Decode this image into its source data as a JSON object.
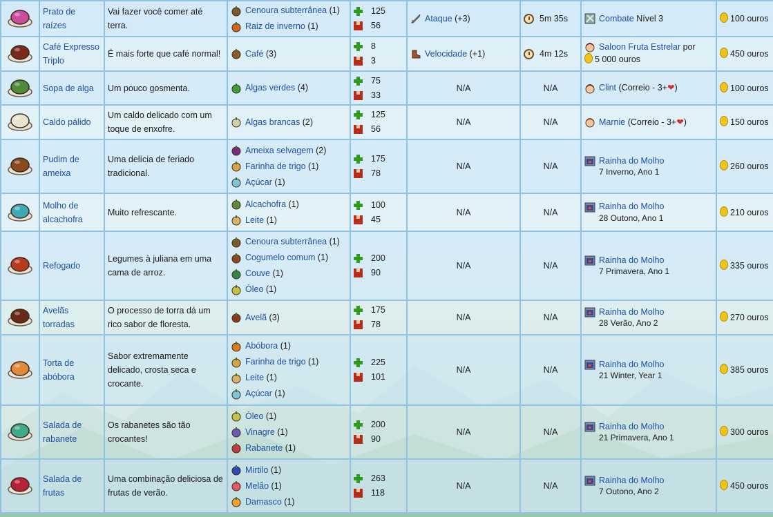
{
  "rows": [
    {
      "name": "Prato de raízes",
      "desc": "Vai fazer você comer até terra.",
      "ingredients": [
        {
          "name": "Cenoura subterrânea",
          "qty": "(1)",
          "icon": "carrot-icon",
          "color": "#7a5a2a"
        },
        {
          "name": "Raiz de inverno",
          "qty": "(1)",
          "icon": "winter-root-icon",
          "color": "#d9621f"
        }
      ],
      "energy": "125",
      "health": "56",
      "buff_name": "Ataque",
      "buff_value": "(+3)",
      "buff_icon": "sword-icon",
      "duration": "5m 35s",
      "source_link": "Combate",
      "source_extra": "Nível 3",
      "source_icon": "combat-icon",
      "price": "100 ouros",
      "dish_color": "#c94f9e",
      "dish_icon": "root-platter-icon"
    },
    {
      "name": "Café Expresso Triplo",
      "desc": "É mais forte que café normal!",
      "ingredients": [
        {
          "name": "Café",
          "qty": "(3)",
          "icon": "coffee-icon",
          "color": "#8b5a2b"
        }
      ],
      "energy": "8",
      "health": "3",
      "buff_name": "Velocidade",
      "buff_value": "(+1)",
      "buff_icon": "boot-icon",
      "duration": "4m 12s",
      "source_link": "Saloon Fruta Estrelar",
      "source_extra": "por",
      "source_price": "5 000 ouros",
      "source_icon": "gus-icon",
      "price": "450 ouros",
      "dish_color": "#7a2a1a",
      "dish_icon": "espresso-icon"
    },
    {
      "name": "Sopa de alga",
      "desc": "Um pouco gosmenta.",
      "ingredients": [
        {
          "name": "Algas verdes",
          "qty": "(4)",
          "icon": "green-algae-icon",
          "color": "#3f9e3a"
        }
      ],
      "energy": "75",
      "health": "33",
      "buff_na": "N/A",
      "duration_na": "N/A",
      "source_link": "Clint",
      "source_extra": "(Correio - 3+",
      "source_icon": "clint-icon",
      "price": "100 ouros",
      "dish_color": "#4d8d3a",
      "dish_icon": "algae-soup-icon"
    },
    {
      "name": "Caldo pálido",
      "desc": "Um caldo delicado com um toque de enxofre.",
      "ingredients": [
        {
          "name": "Algas brancas",
          "qty": "(2)",
          "icon": "white-algae-icon",
          "color": "#d6d0a8"
        }
      ],
      "energy": "125",
      "health": "56",
      "buff_na": "N/A",
      "duration_na": "N/A",
      "source_link": "Marnie",
      "source_extra": "(Correio - 3+",
      "source_icon": "marnie-icon",
      "price": "150 ouros",
      "dish_color": "#e8e4d2",
      "dish_icon": "pale-broth-icon"
    },
    {
      "name": "Pudim de ameixa",
      "desc": "Uma delícia de feriado tradicional.",
      "ingredients": [
        {
          "name": "Ameixa selvagem",
          "qty": "(2)",
          "icon": "wild-plum-icon",
          "color": "#7a2a7a"
        },
        {
          "name": "Farinha de trigo",
          "qty": "(1)",
          "icon": "flour-icon",
          "color": "#d9a34a"
        },
        {
          "name": "Açúcar",
          "qty": "(1)",
          "icon": "sugar-icon",
          "color": "#7fc6d8"
        }
      ],
      "energy": "175",
      "health": "78",
      "buff_na": "N/A",
      "duration_na": "N/A",
      "source_link": "Rainha do Molho",
      "source_extra": "7 Inverno, Ano 1",
      "source_icon": "tv-icon",
      "price": "260 ouros",
      "dish_color": "#8a4a1f",
      "dish_icon": "plum-pudding-icon"
    },
    {
      "name": "Molho de alcachofra",
      "desc": "Muito refrescante.",
      "ingredients": [
        {
          "name": "Alcachofra",
          "qty": "(1)",
          "icon": "artichoke-icon",
          "color": "#5a8a3a"
        },
        {
          "name": "Leite",
          "qty": "(1)",
          "icon": "milk-icon",
          "color": "#d9b26a"
        }
      ],
      "energy": "100",
      "health": "45",
      "buff_na": "N/A",
      "duration_na": "N/A",
      "source_link": "Rainha do Molho",
      "source_extra": "28 Outono, Ano 1",
      "source_icon": "tv-icon",
      "price": "210 ouros",
      "dish_color": "#3fa9b8",
      "dish_icon": "artichoke-dip-icon"
    },
    {
      "name": "Refogado",
      "desc": "Legumes à juliana em uma cama de arroz.",
      "ingredients": [
        {
          "name": "Cenoura subterrânea",
          "qty": "(1)",
          "icon": "carrot-icon",
          "color": "#7a5a2a"
        },
        {
          "name": "Cogumelo comum",
          "qty": "(1)",
          "icon": "mushroom-icon",
          "color": "#8a4a1f"
        },
        {
          "name": "Couve",
          "qty": "(1)",
          "icon": "kale-icon",
          "color": "#2f8a4a"
        },
        {
          "name": "Óleo",
          "qty": "(1)",
          "icon": "oil-icon",
          "color": "#c9c24a"
        }
      ],
      "energy": "200",
      "health": "90",
      "buff_na": "N/A",
      "duration_na": "N/A",
      "source_link": "Rainha do Molho",
      "source_extra": "7 Primavera, Ano 1",
      "source_icon": "tv-icon",
      "price": "335 ouros",
      "dish_color": "#b83a1f",
      "dish_icon": "stir-fry-icon"
    },
    {
      "name": "Avelãs torradas",
      "desc": "O processo de torra dá um rico sabor de floresta.",
      "ingredients": [
        {
          "name": "Avelã",
          "qty": "(3)",
          "icon": "hazelnut-icon",
          "color": "#8a3a1a"
        }
      ],
      "energy": "175",
      "health": "78",
      "buff_na": "N/A",
      "duration_na": "N/A",
      "source_link": "Rainha do Molho",
      "source_extra": "28 Verão, Ano 2",
      "source_icon": "tv-icon",
      "price": "270 ouros",
      "dish_color": "#6a2a18",
      "dish_icon": "roasted-hazelnuts-icon"
    },
    {
      "name": "Torta de abóbora",
      "desc": "Sabor extremamente delicado, crosta seca e crocante.",
      "ingredients": [
        {
          "name": "Abóbora",
          "qty": "(1)",
          "icon": "pumpkin-icon",
          "color": "#e07a1f"
        },
        {
          "name": "Farinha de trigo",
          "qty": "(1)",
          "icon": "flour-icon",
          "color": "#d9a34a"
        },
        {
          "name": "Leite",
          "qty": "(1)",
          "icon": "milk-icon",
          "color": "#d9b26a"
        },
        {
          "name": "Açúcar",
          "qty": "(1)",
          "icon": "sugar-icon",
          "color": "#7fc6d8"
        }
      ],
      "energy": "225",
      "health": "101",
      "buff_na": "N/A",
      "duration_na": "N/A",
      "source_link": "Rainha do Molho",
      "source_extra": "21 Winter, Year 1",
      "source_icon": "tv-icon",
      "price": "385 ouros",
      "dish_color": "#e08a3a",
      "dish_icon": "pumpkin-pie-icon"
    },
    {
      "name": "Salada de rabanete",
      "desc": "Os rabanetes são tão crocantes!",
      "ingredients": [
        {
          "name": "Óleo",
          "qty": "(1)",
          "icon": "oil-icon",
          "color": "#c9c24a"
        },
        {
          "name": "Vinagre",
          "qty": "(1)",
          "icon": "vinegar-icon",
          "color": "#6a5ab8"
        },
        {
          "name": "Rabanete",
          "qty": "(1)",
          "icon": "radish-icon",
          "color": "#c23a4a"
        }
      ],
      "energy": "200",
      "health": "90",
      "buff_na": "N/A",
      "duration_na": "N/A",
      "source_link": "Rainha do Molho",
      "source_extra": "21 Primavera, Ano 1",
      "source_icon": "tv-icon",
      "price": "300 ouros",
      "dish_color": "#3fa98a",
      "dish_icon": "radish-salad-icon"
    },
    {
      "name": "Salada de frutas",
      "desc": "Uma combinação deliciosa de frutas de verão.",
      "ingredients": [
        {
          "name": "Mirtilo",
          "qty": "(1)",
          "icon": "blueberry-icon",
          "color": "#2a4ab8"
        },
        {
          "name": "Melão",
          "qty": "(1)",
          "icon": "melon-icon",
          "color": "#e05a6a"
        },
        {
          "name": "Damasco",
          "qty": "(1)",
          "icon": "apricot-icon",
          "color": "#f0a030"
        }
      ],
      "energy": "263",
      "health": "118",
      "buff_na": "N/A",
      "duration_na": "N/A",
      "source_link": "Rainha do Molho",
      "source_extra": "7 Outono, Ano 2",
      "source_icon": "tv-icon",
      "price": "450 ouros",
      "dish_color": "#b8203a",
      "dish_icon": "fruit-salad-icon"
    }
  ],
  "mail_suffix": ")",
  "colors": {
    "link": "#1d4fa6",
    "border": "#8fc3e6",
    "energy": "#2f9a1e",
    "health": "#b72b18",
    "coin": "#f0c419"
  }
}
